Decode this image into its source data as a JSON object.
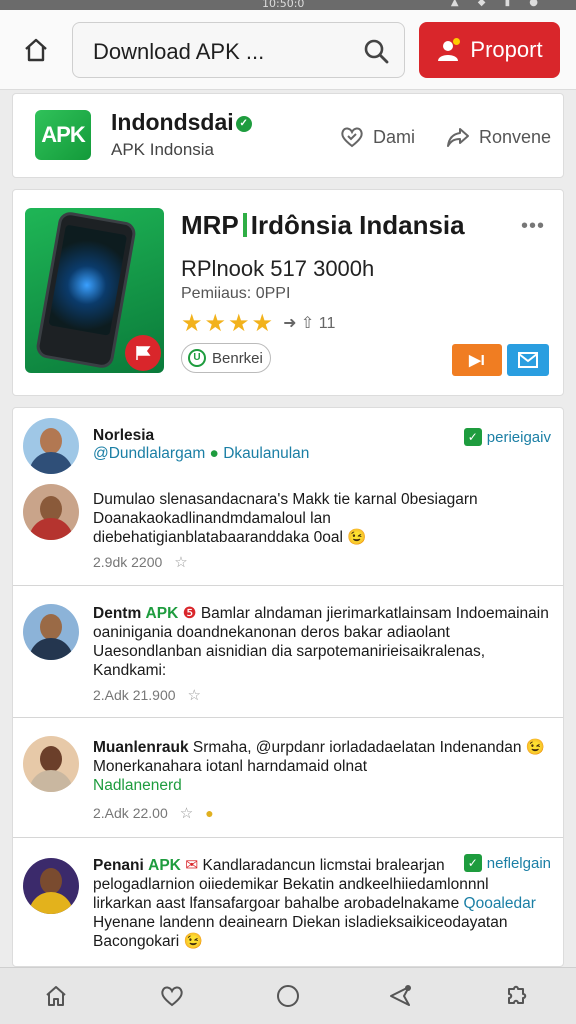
{
  "status": {
    "text": "10:50:0",
    "icons": "▲ ◆ ▮ ●"
  },
  "search": {
    "text": "Download APK ..."
  },
  "header": {
    "report_label": "Proport"
  },
  "developer": {
    "name": "Indondsdai",
    "subtitle": "APK Indonsia",
    "logo_text": "APK",
    "action1": "Dami",
    "action2": "Ronvene"
  },
  "app": {
    "title_a": "MRP",
    "title_b": "Irdônsia Indansia",
    "size": "RPlnook 517 3000h",
    "permissions": "Pemiiaus: 0PPI",
    "rating_count": "11",
    "stars": 4,
    "badge_label": "Benrkei",
    "orange_label": "▶I"
  },
  "posts": [
    {
      "name": "Norlesia",
      "handle": "@Dundlalargam",
      "handle2": "Dkaulanulan",
      "verify": "perieigaiv",
      "text": "Dumulao slenasandacnara's Makk tie karnal 0besiagarn Doanakaokadlinandmdamaloul lan diebehatigianblatabaaranddaka 0oal",
      "emoji": "😉",
      "meta": "2.9dk  2200"
    },
    {
      "name": "Dentm",
      "tag": "APK",
      "text": "Bamlar alndaman jierimarkatlainsam Indoemainain oaninigania doandnekanonan deros bakar adiaolant Uaesondlanban aisnidian dia sarpotemanirieisaikralenas, Kandkami:",
      "meta": "2.Adk  21.900"
    },
    {
      "name": "Muanlenrauk",
      "text_a": "Srmaha, @urpdanr iorladadaelatan Indenandan",
      "text_b": "Monerkanahara iotanl harndamaid olnat",
      "green_line": "Nadlanenerd",
      "meta": "2.Adk  22.00"
    },
    {
      "name": "Penani",
      "tag": "APK",
      "text_a": "Kandlaradancun licmstai bralearjan",
      "verify": "neflelgain",
      "text_b": "pelogadlarnion oiiedemikar Bekatin andkeelhiiedamlonnnl lirkarkan aast lfansafargoar bahalbe arobadelnakame",
      "teal_word": "Qooaledar",
      "text_c": "Hyenane landenn deainearn Diekan isladieksaikiceodayatan Bacongokari",
      "meta": ""
    }
  ],
  "nav": [
    "home-icon",
    "heart-icon",
    "circle-icon",
    "send-icon",
    "puzzle-icon"
  ],
  "colors": {
    "brand_red": "#d9262b",
    "brand_green": "#1e9c3e",
    "orange": "#f07d22",
    "blue": "#2a9ee0"
  }
}
